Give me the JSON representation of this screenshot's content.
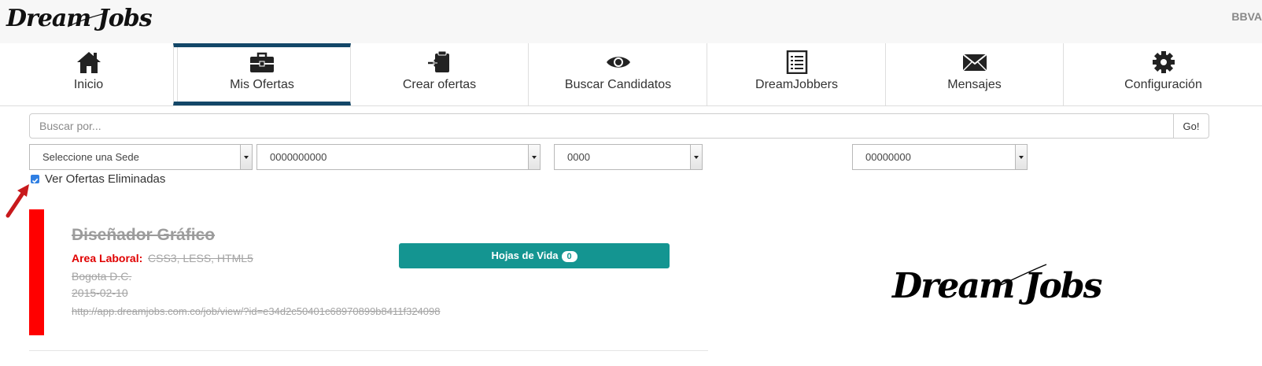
{
  "header": {
    "brand": "Dream Jobs",
    "user": "BBVA"
  },
  "nav": [
    {
      "label": "Inicio",
      "icon": "home-icon"
    },
    {
      "label": "Mis Ofertas",
      "icon": "briefcase-icon",
      "active": true
    },
    {
      "label": "Crear ofertas",
      "icon": "clipboard-icon"
    },
    {
      "label": "Buscar Candidatos",
      "icon": "eye-icon"
    },
    {
      "label": "DreamJobbers",
      "icon": "list-icon"
    },
    {
      "label": "Mensajes",
      "icon": "envelope-icon"
    },
    {
      "label": "Configuración",
      "icon": "gear-icon"
    }
  ],
  "search": {
    "placeholder": "Buscar por...",
    "value": "",
    "button": "Go!"
  },
  "filters": {
    "sede": "Seleccione una Sede",
    "filter2": "0000000000",
    "filter3": "0000",
    "filter4": "00000000"
  },
  "deleted_checkbox": {
    "label": "Ver Ofertas Eliminadas",
    "checked": true
  },
  "offer": {
    "title": "Diseñador Gráfico",
    "area_label": "Area Laboral:",
    "area_value": "CSS3, LESS, HTML5",
    "city": "Bogota D.C.",
    "date": "2015-02-10",
    "url": "http://app.dreamjobs.com.co/job/view/?id=e34d2c50401c68970899b8411f324098",
    "cv_button": "Hojas de Vida",
    "cv_count": "0",
    "company_logo": "Dream Jobs"
  },
  "colors": {
    "nav_active": "#134768",
    "accent": "#149591",
    "deleted_marker": "#ff0000",
    "area_label": "#e00000"
  }
}
